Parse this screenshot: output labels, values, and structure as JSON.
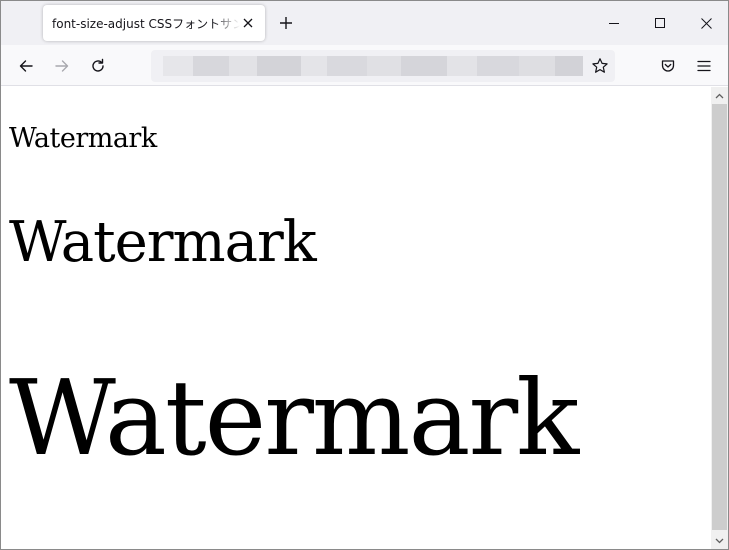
{
  "browser": {
    "tab_title": "font-size-adjust CSSフォントサンプルページ",
    "address_text": ""
  },
  "content": {
    "samples": [
      "Watermark",
      "Watermark",
      "Watermark"
    ]
  },
  "colors": {
    "tabstrip_bg": "#f0f0f4",
    "toolbar_bg": "#f9f9fb",
    "text": "#000000",
    "scroll_thumb": "#cdcdcd"
  }
}
